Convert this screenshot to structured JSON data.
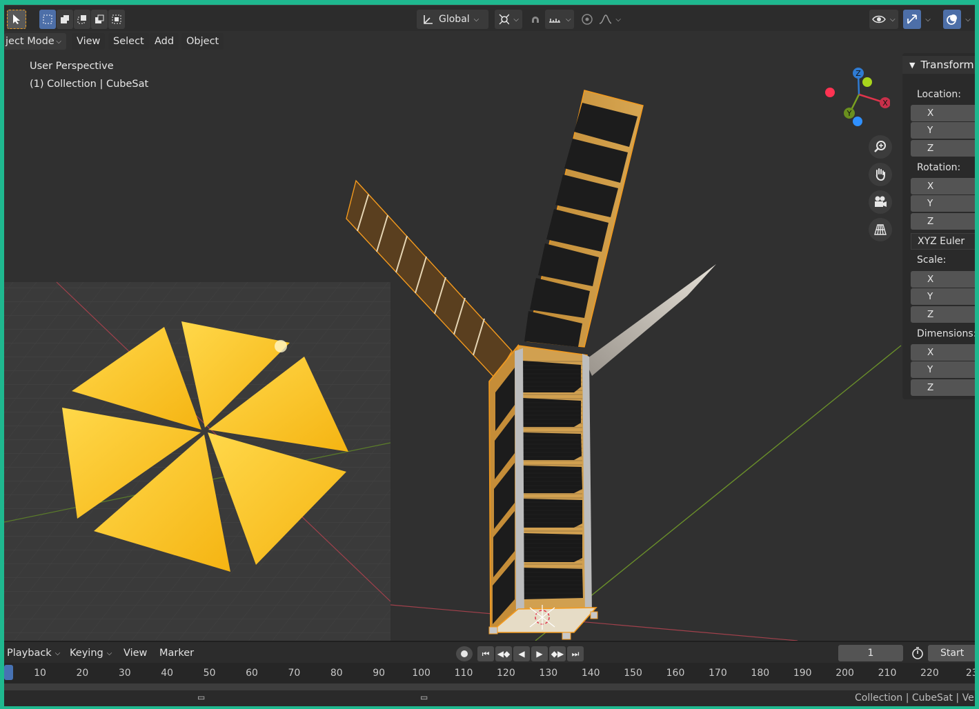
{
  "header": {
    "transform_orientation": "Global"
  },
  "menubar": {
    "mode": "ject Mode",
    "items": [
      "View",
      "Select",
      "Add",
      "Object"
    ]
  },
  "viewport": {
    "perspective": "User Perspective",
    "collection": "(1) Collection | CubeSat"
  },
  "gizmo": {
    "z": "Z",
    "x": "X",
    "y": "Y"
  },
  "npanel": {
    "title": "Transform",
    "location_label": "Location:",
    "rotation_label": "Rotation:",
    "rotation_mode": "XYZ Euler",
    "scale_label": "Scale:",
    "dimensions_label": "Dimensions:",
    "axes": [
      "X",
      "Y",
      "Z"
    ]
  },
  "timeline": {
    "menus": [
      "Playback",
      "Keying",
      "View",
      "Marker"
    ],
    "current_frame": "1",
    "start_label": "Start",
    "ticks": [
      "10",
      "20",
      "30",
      "40",
      "50",
      "60",
      "70",
      "80",
      "90",
      "100",
      "110",
      "120",
      "130",
      "140",
      "150",
      "160",
      "170",
      "180",
      "190",
      "200",
      "210",
      "220",
      "23"
    ]
  },
  "statusbar": {
    "info": "Collection | CubeSat | Vert"
  },
  "colors": {
    "accent_frame": "#1fb88f",
    "selection_outline": "#f39a1e",
    "axis_x": "#e0344b",
    "axis_y": "#7aa021",
    "axis_z": "#2f7bd2"
  }
}
